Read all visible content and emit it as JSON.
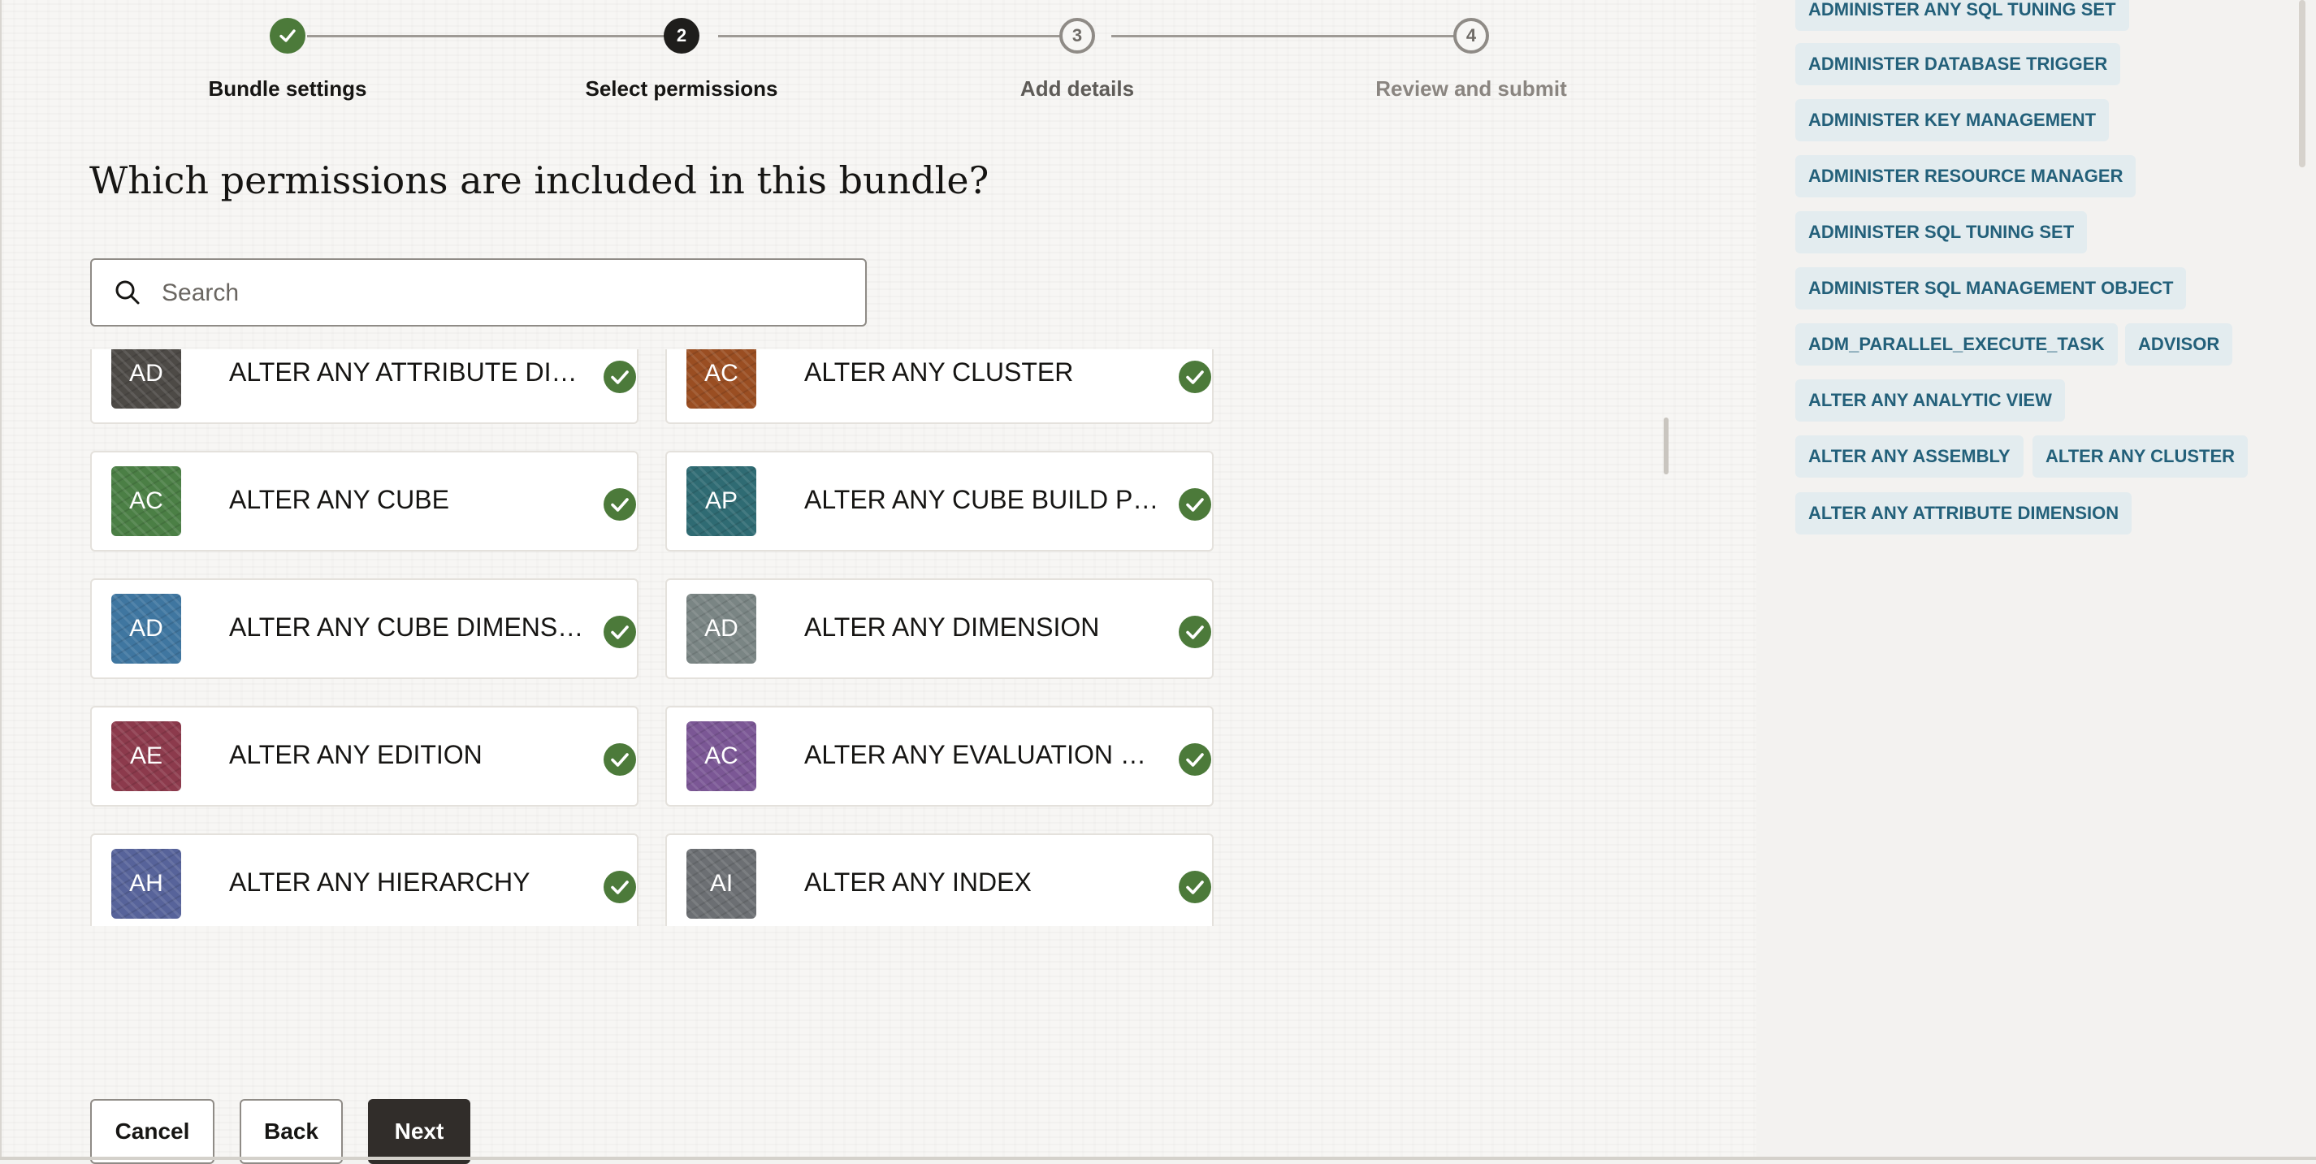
{
  "stepper": {
    "steps": [
      {
        "number": "1",
        "label": "Bundle settings",
        "state": "done"
      },
      {
        "number": "2",
        "label": "Select permissions",
        "state": "current"
      },
      {
        "number": "3",
        "label": "Add details",
        "state": "todo"
      },
      {
        "number": "4",
        "label": "Review and submit",
        "state": "todo"
      }
    ]
  },
  "main": {
    "heading": "Which permissions are included in this bundle?",
    "search": {
      "placeholder": "Search",
      "value": ""
    }
  },
  "permissions": [
    {
      "initials": "AD",
      "label": "ALTER ANY ATTRIBUTE DIMENSION",
      "color": "#4d4a46",
      "selected": true
    },
    {
      "initials": "AC",
      "label": "ALTER ANY CLUSTER",
      "color": "#9a4e22",
      "selected": true
    },
    {
      "initials": "AC",
      "label": "ALTER ANY CUBE",
      "color": "#4b7f45",
      "selected": true
    },
    {
      "initials": "AP",
      "label": "ALTER ANY CUBE BUILD PROCESS",
      "color": "#2f6b73",
      "selected": true
    },
    {
      "initials": "AD",
      "label": "ALTER ANY CUBE DIMENSION",
      "color": "#3f76a0",
      "selected": true
    },
    {
      "initials": "AD",
      "label": "ALTER ANY DIMENSION",
      "color": "#7a8584",
      "selected": true
    },
    {
      "initials": "AE",
      "label": "ALTER ANY EDITION",
      "color": "#8c3a4c",
      "selected": true
    },
    {
      "initials": "AC",
      "label": "ALTER ANY EVALUATION CONTEXT",
      "color": "#7b5795",
      "selected": true
    },
    {
      "initials": "AH",
      "label": "ALTER ANY HIERARCHY",
      "color": "#57639a",
      "selected": true
    },
    {
      "initials": "AI",
      "label": "ALTER ANY INDEX",
      "color": "#6c6f73",
      "selected": true
    }
  ],
  "buttons": {
    "cancel": "Cancel",
    "back": "Back",
    "next": "Next"
  },
  "selected_panel": {
    "chips": [
      "ADMINISTER ANY SQL TUNING SET",
      "ADMINISTER DATABASE TRIGGER",
      "ADMINISTER KEY MANAGEMENT",
      "ADMINISTER RESOURCE MANAGER",
      "ADMINISTER SQL TUNING SET",
      "ADMINISTER SQL MANAGEMENT OBJECT",
      "ADM_PARALLEL_EXECUTE_TASK",
      "ADVISOR",
      "ALTER ANY ANALYTIC VIEW",
      "ALTER ANY ASSEMBLY",
      "ALTER ANY CLUSTER",
      "ALTER ANY ATTRIBUTE DIMENSION"
    ]
  },
  "colors": {
    "accent_green": "#4c7a3a",
    "chip_bg": "#e3ecef",
    "chip_text": "#23607a",
    "primary_button": "#312d2a"
  }
}
